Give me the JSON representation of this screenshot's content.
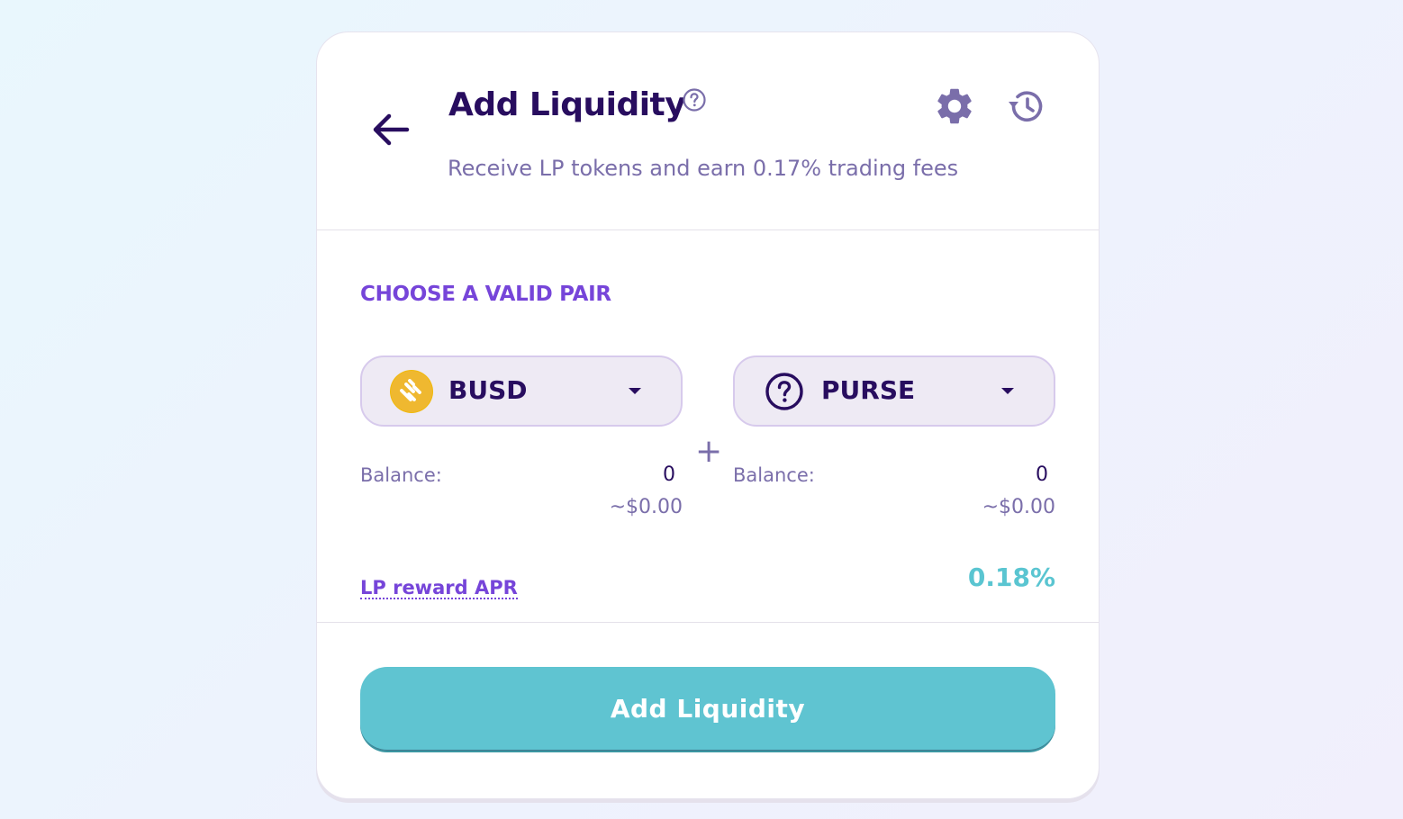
{
  "header": {
    "title": "Add Liquidity",
    "subtitle": "Receive LP tokens and earn 0.17% trading fees"
  },
  "pair": {
    "label": "CHOOSE A VALID PAIR",
    "plus": "+",
    "token_a": {
      "symbol": "BUSD",
      "icon": "busd-coin-icon",
      "balance_label": "Balance:",
      "balance": "0",
      "usd_value": "~$0.00"
    },
    "token_b": {
      "symbol": "PURSE",
      "icon": "unknown-token-question-icon",
      "balance_label": "Balance:",
      "balance": "0",
      "usd_value": "~$0.00"
    }
  },
  "apr": {
    "label": "LP reward APR",
    "value": "0.18%"
  },
  "actions": {
    "add_label": "Add Liquidity"
  },
  "colors": {
    "primary_text": "#280d5f",
    "secondary_text": "#7a6eaa",
    "accent_purple": "#7645d9",
    "accent_teal": "#5fc4d1",
    "busd_yellow": "#f0b90b"
  }
}
